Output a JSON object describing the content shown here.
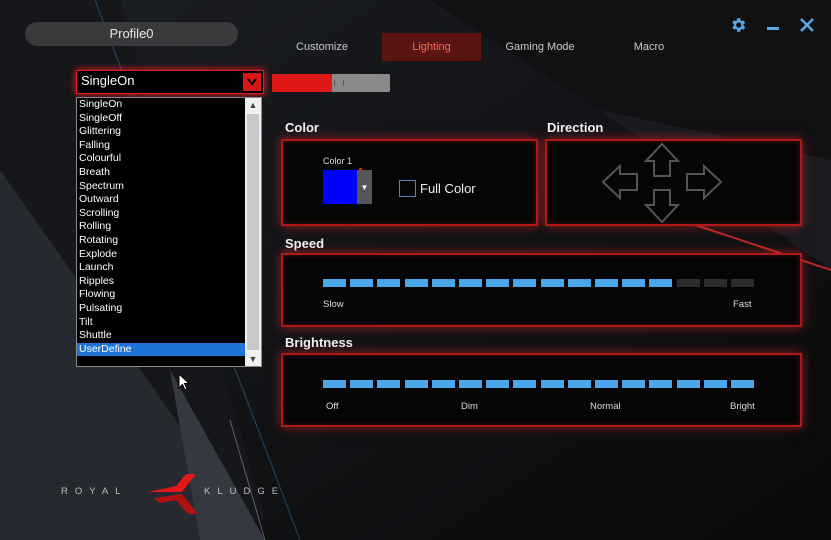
{
  "profile": {
    "name": "Profile0"
  },
  "tabs": [
    {
      "label": "Customize",
      "active": false
    },
    {
      "label": "Lighting",
      "active": true
    },
    {
      "label": "Gaming Mode",
      "active": false
    },
    {
      "label": "Macro",
      "active": false
    }
  ],
  "window_controls": {
    "settings_icon": "gear-icon",
    "minimize_icon": "minimize-icon",
    "close_icon": "close-icon"
  },
  "mode_select": {
    "value": "SingleOn",
    "options": [
      "SingleOn",
      "SingleOff",
      "Glittering",
      "Falling",
      "Colourful",
      "Breath",
      "Spectrum",
      "Outward",
      "Scrolling",
      "Rolling",
      "Rotating",
      "Explode",
      "Launch",
      "Ripples",
      "Flowing",
      "Pulsating",
      "Tilt",
      "Shuttle",
      "UserDefine"
    ],
    "highlighted": "UserDefine"
  },
  "power_toggle": {
    "state": "on"
  },
  "color": {
    "heading": "Color",
    "swatch_label": "Color 1",
    "swatch_color": "#0000ff",
    "full_color_label": "Full Color",
    "full_color_checked": false
  },
  "direction": {
    "heading": "Direction",
    "icons": [
      "arrow-left-icon",
      "arrow-up-icon",
      "arrow-down-icon",
      "arrow-right-icon"
    ]
  },
  "speed": {
    "heading": "Speed",
    "segments_total": 16,
    "segments_filled": 13,
    "min_label": "Slow",
    "max_label": "Fast"
  },
  "brightness": {
    "heading": "Brightness",
    "segments_total": 16,
    "segments_filled": 16,
    "labels": [
      "Off",
      "Dim",
      "Normal",
      "Bright"
    ]
  },
  "brand": {
    "left": "ROYAL",
    "right": "KLUDGE"
  },
  "colors": {
    "accent": "#e01818",
    "segment_on": "#4aa8e8",
    "segment_off": "#2c2c2c",
    "selection": "#1e73d6"
  }
}
